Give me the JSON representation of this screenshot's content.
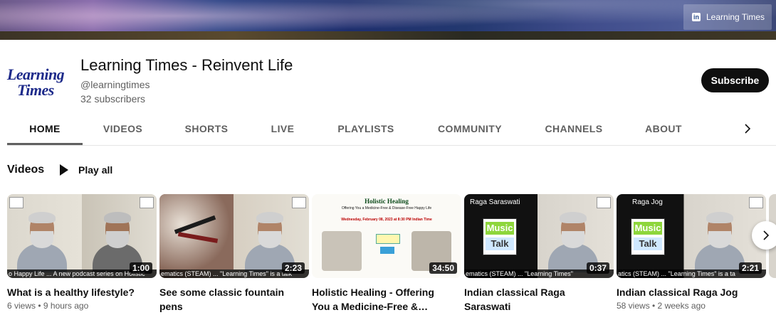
{
  "banner": {
    "link_label": "Learning Times",
    "link_icon": "linkedin-icon"
  },
  "channel": {
    "avatar_line1": "Learning",
    "avatar_line2": "Times",
    "title": "Learning Times - Reinvent Life",
    "handle": "@learningtimes",
    "subscribers": "32 subscribers",
    "subscribe_label": "Subscribe"
  },
  "tabs": [
    "HOME",
    "VIDEOS",
    "SHORTS",
    "LIVE",
    "PLAYLISTS",
    "COMMUNITY",
    "CHANNELS",
    "ABOUT"
  ],
  "active_tab": "HOME",
  "section": {
    "title": "Videos",
    "play_all": "Play all"
  },
  "videos": [
    {
      "title": "What is a healthy lifestyle?",
      "duration": "1:00",
      "strip": "o Happy Life ... A new podcast series on Holistic",
      "meta": "6 views • 9 hours ago"
    },
    {
      "title": "See some classic fountain pens",
      "duration": "2:23",
      "strip": "ematics (STEAM) ...   \"Learning Times\" is a talk",
      "meta": ""
    },
    {
      "title": "Holistic Healing - Offering You a Medicine-Free &…",
      "duration": "34:50",
      "strip": "",
      "thumb_heading": "Holistic Healing",
      "thumb_sub": "Offering You a Medicine-Free & Disease-Free Happy Life",
      "thumb_date": "Wednesday, February 08, 2023 at 8:30 PM Indian Time",
      "meta": ""
    },
    {
      "title": "Indian classical Raga Saraswati",
      "duration": "0:37",
      "strip": "ematics (STEAM) ...   \"Learning Times\"",
      "thumb_label": "Raga Saraswati",
      "meta": ""
    },
    {
      "title": "Indian classical Raga Jog",
      "duration": "2:21",
      "strip": "atics (STEAM) ...   \"Learning Times\" is a ta",
      "thumb_label": "Raga Jog",
      "meta": "58 views • 2 weeks ago"
    }
  ],
  "music_talk": {
    "line1": "Music",
    "line2": "Talk"
  },
  "colors": {
    "subscribe_bg": "#0f0f0f",
    "meta_text": "#606060",
    "music_green": "#8ed63c"
  }
}
